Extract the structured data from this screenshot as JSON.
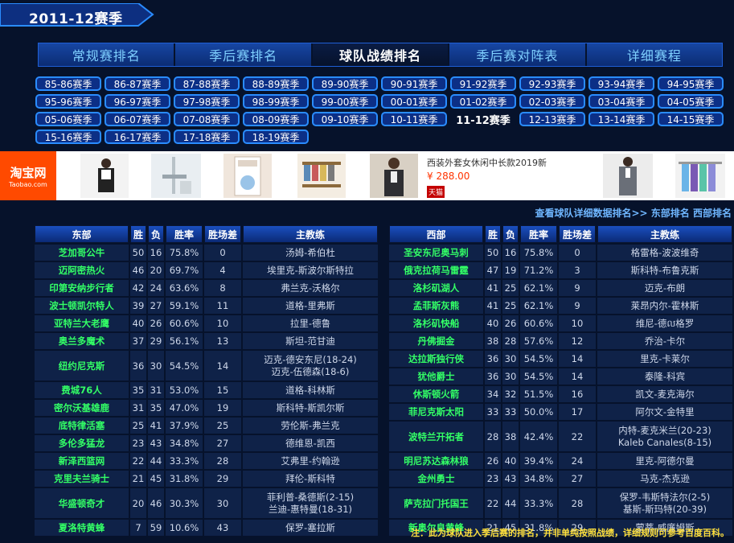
{
  "season_title": "2011-12赛季",
  "main_tabs": [
    {
      "label": "常规赛排名",
      "active": false
    },
    {
      "label": "季后赛排名",
      "active": false
    },
    {
      "label": "球队战绩排名",
      "active": true
    },
    {
      "label": "季后赛对阵表",
      "active": false
    },
    {
      "label": "详细赛程",
      "active": false
    }
  ],
  "seasons": [
    "85-86赛季",
    "86-87赛季",
    "87-88赛季",
    "88-89赛季",
    "89-90赛季",
    "90-91赛季",
    "91-92赛季",
    "92-93赛季",
    "93-94赛季",
    "94-95赛季",
    "95-96赛季",
    "96-97赛季",
    "97-98赛季",
    "98-99赛季",
    "99-00赛季",
    "00-01赛季",
    "01-02赛季",
    "02-03赛季",
    "03-04赛季",
    "04-05赛季",
    "05-06赛季",
    "06-07赛季",
    "07-08赛季",
    "08-09赛季",
    "09-10赛季",
    "10-11赛季",
    "11-12赛季",
    "12-13赛季",
    "13-14赛季",
    "14-15赛季",
    "15-16赛季",
    "16-17赛季",
    "17-18赛季",
    "18-19赛季"
  ],
  "current_season": "11-12赛季",
  "ad": {
    "logo_main": "淘宝网",
    "logo_sub": "Taobao.com",
    "caption": "西装外套女休闲中长款2019新",
    "price": "¥ 288.00",
    "badge": "天猫"
  },
  "links": {
    "detail": "查看球队详细数据排名>>",
    "east": "东部排名",
    "west": "西部排名"
  },
  "columns": {
    "win": "胜",
    "loss": "负",
    "pct": "胜率",
    "gb": "胜场差",
    "coach": "主教练"
  },
  "east": {
    "header": "东部",
    "rows": [
      {
        "team": "芝加哥公牛",
        "w": "50",
        "l": "16",
        "pct": "75.8%",
        "gb": "0",
        "coach": [
          "汤姆-希伯杜"
        ]
      },
      {
        "team": "迈阿密热火",
        "w": "46",
        "l": "20",
        "pct": "69.7%",
        "gb": "4",
        "coach": [
          "埃里克-斯波尔斯特拉"
        ]
      },
      {
        "team": "印第安纳步行者",
        "w": "42",
        "l": "24",
        "pct": "63.6%",
        "gb": "8",
        "coach": [
          "弗兰克-沃格尔"
        ]
      },
      {
        "team": "波士顿凯尔特人",
        "w": "39",
        "l": "27",
        "pct": "59.1%",
        "gb": "11",
        "coach": [
          "道格-里弗斯"
        ]
      },
      {
        "team": "亚特兰大老鹰",
        "w": "40",
        "l": "26",
        "pct": "60.6%",
        "gb": "10",
        "coach": [
          "拉里-德鲁"
        ]
      },
      {
        "team": "奥兰多魔术",
        "w": "37",
        "l": "29",
        "pct": "56.1%",
        "gb": "13",
        "coach": [
          "斯坦-范甘迪"
        ]
      },
      {
        "team": "纽约尼克斯",
        "w": "36",
        "l": "30",
        "pct": "54.5%",
        "gb": "14",
        "coach": [
          "迈克-德安东尼(18-24)",
          "迈克-伍德森(18-6)"
        ]
      },
      {
        "team": "费城76人",
        "w": "35",
        "l": "31",
        "pct": "53.0%",
        "gb": "15",
        "coach": [
          "道格-科林斯"
        ]
      },
      {
        "team": "密尔沃基雄鹿",
        "w": "31",
        "l": "35",
        "pct": "47.0%",
        "gb": "19",
        "coach": [
          "斯科特-斯凯尔斯"
        ]
      },
      {
        "team": "底特律活塞",
        "w": "25",
        "l": "41",
        "pct": "37.9%",
        "gb": "25",
        "coach": [
          "劳伦斯-弗兰克"
        ]
      },
      {
        "team": "多伦多猛龙",
        "w": "23",
        "l": "43",
        "pct": "34.8%",
        "gb": "27",
        "coach": [
          "德维恩-凯西"
        ]
      },
      {
        "team": "新泽西篮网",
        "w": "22",
        "l": "44",
        "pct": "33.3%",
        "gb": "28",
        "coach": [
          "艾弗里-约翰逊"
        ]
      },
      {
        "team": "克里夫兰骑士",
        "w": "21",
        "l": "45",
        "pct": "31.8%",
        "gb": "29",
        "coach": [
          "拜伦-斯科特"
        ]
      },
      {
        "team": "华盛顿奇才",
        "w": "20",
        "l": "46",
        "pct": "30.3%",
        "gb": "30",
        "coach": [
          "菲利普-桑德斯(2-15)",
          "兰迪-惠特曼(18-31)"
        ]
      },
      {
        "team": "夏洛特黄蜂",
        "w": "7",
        "l": "59",
        "pct": "10.6%",
        "gb": "43",
        "coach": [
          "保罗-塞拉斯"
        ]
      }
    ]
  },
  "west": {
    "header": "西部",
    "rows": [
      {
        "team": "圣安东尼奥马刺",
        "w": "50",
        "l": "16",
        "pct": "75.8%",
        "gb": "0",
        "coach": [
          "格雷格-波波维奇"
        ]
      },
      {
        "team": "俄克拉荷马雷霆",
        "w": "47",
        "l": "19",
        "pct": "71.2%",
        "gb": "3",
        "coach": [
          "斯科特-布鲁克斯"
        ]
      },
      {
        "team": "洛杉矶湖人",
        "w": "41",
        "l": "25",
        "pct": "62.1%",
        "gb": "9",
        "coach": [
          "迈克-布朗"
        ]
      },
      {
        "team": "孟菲斯灰熊",
        "w": "41",
        "l": "25",
        "pct": "62.1%",
        "gb": "9",
        "coach": [
          "莱昂内尔-霍林斯"
        ]
      },
      {
        "team": "洛杉矶快船",
        "w": "40",
        "l": "26",
        "pct": "60.6%",
        "gb": "10",
        "coach": [
          "维尼-德ល格罗"
        ]
      },
      {
        "team": "丹佛掘金",
        "w": "38",
        "l": "28",
        "pct": "57.6%",
        "gb": "12",
        "coach": [
          "乔治-卡尔"
        ]
      },
      {
        "team": "达拉斯独行侠",
        "w": "36",
        "l": "30",
        "pct": "54.5%",
        "gb": "14",
        "coach": [
          "里克-卡莱尔"
        ]
      },
      {
        "team": "犹他爵士",
        "w": "36",
        "l": "30",
        "pct": "54.5%",
        "gb": "14",
        "coach": [
          "泰隆-科宾"
        ]
      },
      {
        "team": "休斯顿火箭",
        "w": "34",
        "l": "32",
        "pct": "51.5%",
        "gb": "16",
        "coach": [
          "凯文-麦克海尔"
        ]
      },
      {
        "team": "菲尼克斯太阳",
        "w": "33",
        "l": "33",
        "pct": "50.0%",
        "gb": "17",
        "coach": [
          "阿尔文-金特里"
        ]
      },
      {
        "team": "波特兰开拓者",
        "w": "28",
        "l": "38",
        "pct": "42.4%",
        "gb": "22",
        "coach": [
          "内特-麦克米兰(20-23)",
          "Kaleb Canales(8-15)"
        ]
      },
      {
        "team": "明尼苏达森林狼",
        "w": "26",
        "l": "40",
        "pct": "39.4%",
        "gb": "24",
        "coach": [
          "里克-阿德尔曼"
        ]
      },
      {
        "team": "金州勇士",
        "w": "23",
        "l": "43",
        "pct": "34.8%",
        "gb": "27",
        "coach": [
          "马克-杰克逊"
        ]
      },
      {
        "team": "萨克拉门托国王",
        "w": "22",
        "l": "44",
        "pct": "33.3%",
        "gb": "28",
        "coach": [
          "保罗-韦斯特法尔(2-5)",
          "基斯-斯玛特(20-39)"
        ]
      },
      {
        "team": "新奥尔良黄蜂",
        "w": "21",
        "l": "45",
        "pct": "31.8%",
        "gb": "29",
        "coach": [
          "蒙蒂-威廉姆斯"
        ]
      }
    ]
  },
  "note": "注：此为球队进入季后赛的排名，并非单纯按照战绩，详细规则可参考百度百科。"
}
